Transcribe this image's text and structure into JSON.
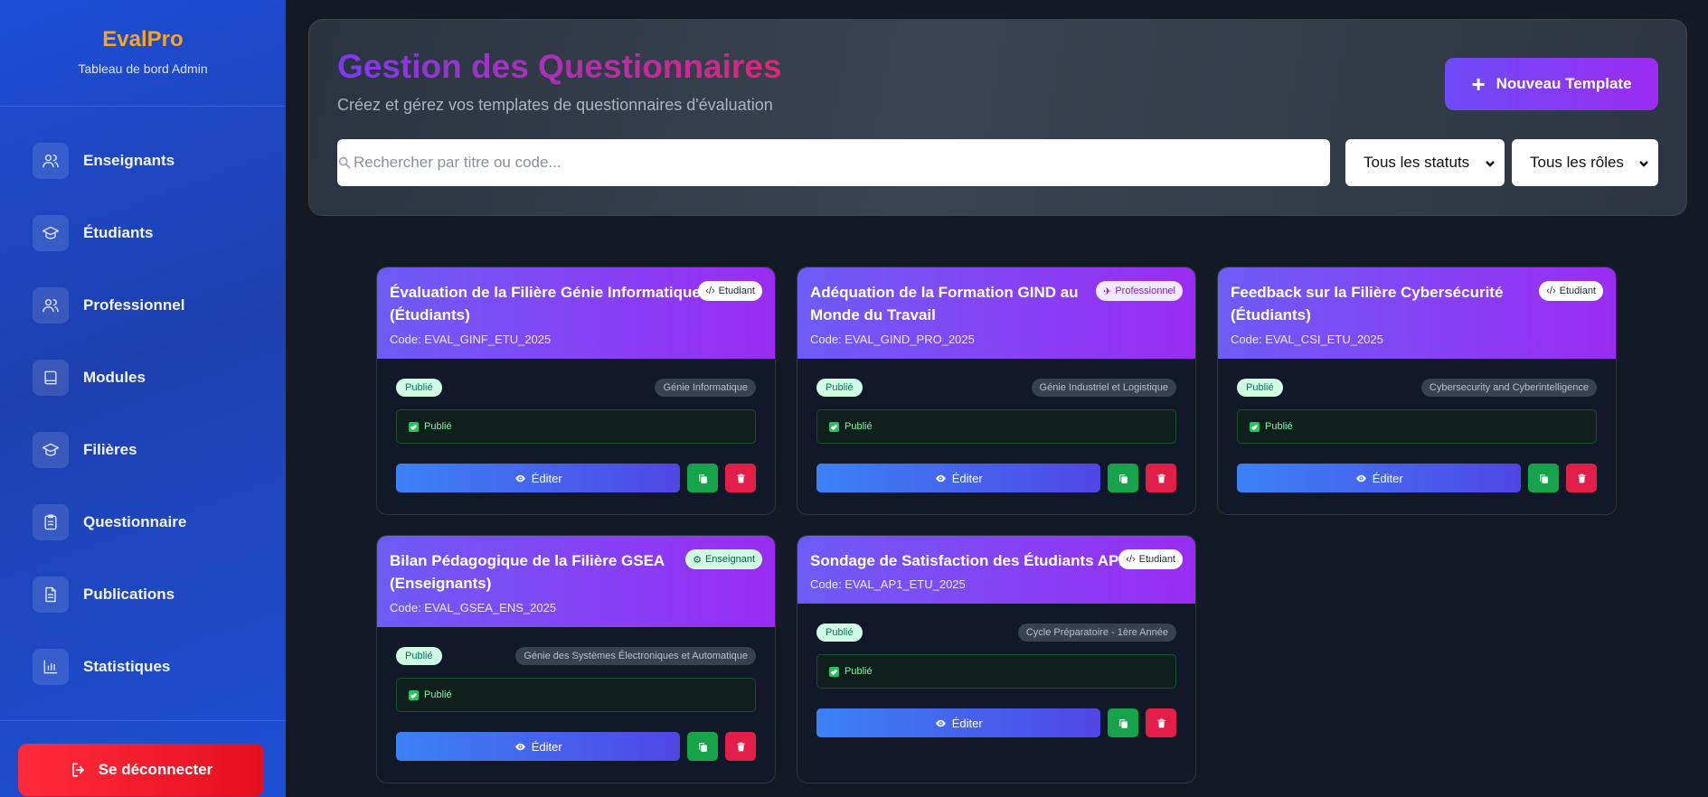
{
  "brand": {
    "name": "EvalPro",
    "subtitle": "Tableau de bord Admin"
  },
  "sidebar": {
    "items": [
      {
        "label": "Enseignants",
        "icon": "users-icon"
      },
      {
        "label": "Étudiants",
        "icon": "graduation-cap-icon"
      },
      {
        "label": "Professionnel",
        "icon": "users-icon"
      },
      {
        "label": "Modules",
        "icon": "book-icon"
      },
      {
        "label": "Filières",
        "icon": "graduation-cap-icon"
      },
      {
        "label": "Questionnaire",
        "icon": "clipboard-icon"
      },
      {
        "label": "Publications",
        "icon": "file-text-icon"
      },
      {
        "label": "Statistiques",
        "icon": "bar-chart-icon"
      }
    ],
    "logout_label": "Se déconnecter"
  },
  "header": {
    "title": "Gestion des Questionnaires",
    "subtitle": "Créez et gérez vos templates de questionnaires d'évaluation",
    "new_button": "Nouveau Template",
    "search_placeholder": "Rechercher par titre ou code...",
    "status_filter": "Tous les statuts",
    "role_filter": "Tous les rôles"
  },
  "colors": {
    "sidebar": "#1d4ed8",
    "brand": "#f5a524",
    "card_header": "#7c3aed",
    "edit": "#3b82f6",
    "copy": "#16a34a",
    "delete": "#e11d48",
    "logout": "#ff2a3d"
  },
  "cards": [
    {
      "title": "Évaluation de la Filière Génie Informatique (Étudiants)",
      "code": "Code: EVAL_GINF_ETU_2025",
      "role": "Etudiant",
      "status": "Publié",
      "filiere": "Génie Informatique",
      "status_box": "Publié",
      "edit_label": "Éditer"
    },
    {
      "title": "Adéquation de la Formation GIND au Monde du Travail",
      "code": "Code: EVAL_GIND_PRO_2025",
      "role": "Professionnel",
      "status": "Publié",
      "filiere": "Génie Industriel et Logistique",
      "status_box": "Publié",
      "edit_label": "Éditer"
    },
    {
      "title": "Feedback sur la Filière Cybersécurité (Étudiants)",
      "code": "Code: EVAL_CSI_ETU_2025",
      "role": "Etudiant",
      "status": "Publié",
      "filiere": "Cybersecurity and Cyberintelligence",
      "status_box": "Publié",
      "edit_label": "Éditer"
    },
    {
      "title": "Bilan Pédagogique de la Filière GSEA (Enseignants)",
      "code": "Code: EVAL_GSEA_ENS_2025",
      "role": "Enseignant",
      "status": "Publié",
      "filiere": "Génie des Systèmes Électroniques et Automatique",
      "status_box": "Publié",
      "edit_label": "Éditer"
    },
    {
      "title": "Sondage de Satisfaction des Étudiants AP1",
      "code": "Code: EVAL_AP1_ETU_2025",
      "role": "Etudiant",
      "status": "Publié",
      "filiere": "Cycle Préparatoire - 1ère Année",
      "status_box": "Publié",
      "edit_label": "Éditer"
    }
  ]
}
